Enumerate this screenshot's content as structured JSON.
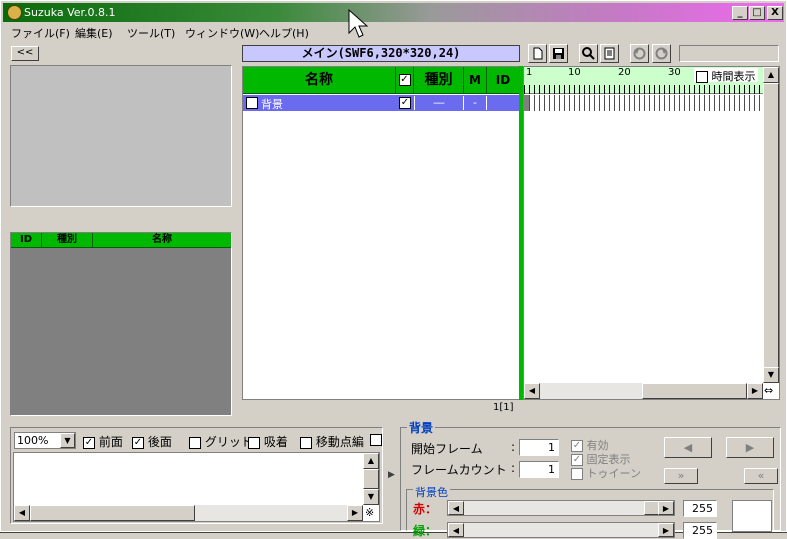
{
  "title": "Suzuka Ver.0.8.1",
  "caption_buttons": {
    "minimize": "_",
    "maximize": "□",
    "close": "X"
  },
  "menu": [
    "ファイル(F)",
    "編集(E)",
    "ツール(T)",
    "ウィンドウ(W)",
    "ヘルプ(H)"
  ],
  "left_panel": {
    "collapse_label": "<<",
    "list_headers": [
      "ID",
      "種別",
      "名称"
    ]
  },
  "scene_title": "メイン(SWF6,320*320,24)",
  "toolbar_icons": [
    "new-file-icon",
    "save-icon",
    "search-icon",
    "document-icon",
    "undo-icon",
    "redo-icon"
  ],
  "layers": {
    "headers": {
      "name": "名称",
      "type": "種別",
      "m": "M",
      "id": "ID"
    },
    "rows": [
      {
        "name": "背景",
        "type": "―",
        "m": "-",
        "id": "",
        "checked": true
      }
    ],
    "footer": "1[1]"
  },
  "timeline": {
    "ticks": [
      "1",
      "10",
      "20",
      "30"
    ],
    "time_display_label": "時間表示"
  },
  "bottom_left": {
    "zoom": "100%",
    "options": [
      {
        "label": "前面",
        "checked": true
      },
      {
        "label": "後面",
        "checked": true
      },
      {
        "label": "グリッド",
        "checked": false
      },
      {
        "label": "吸着",
        "checked": false
      },
      {
        "label": "移動点編",
        "checked": false
      }
    ],
    "corner_mark": "※"
  },
  "properties": {
    "section_title": "背景",
    "start_frame_label": "開始フレーム",
    "start_frame_value": "1",
    "frame_count_label": "フレームカウント",
    "frame_count_value": "1",
    "enabled_label": "有効",
    "fixed_label": "固定表示",
    "tween_label": "トゥイーン",
    "bg_color_title": "背景色",
    "red_label": "赤：",
    "red_value": "255",
    "green_label": "緑：",
    "green_value": "255",
    "nav_prev": "◀",
    "nav_next": "▶",
    "nav_ff": "»",
    "nav_rew": "«"
  },
  "colors": {
    "accent_green": "#00b800",
    "selection": "#6b6bf0",
    "scene_bar": "#c8c8ff"
  }
}
